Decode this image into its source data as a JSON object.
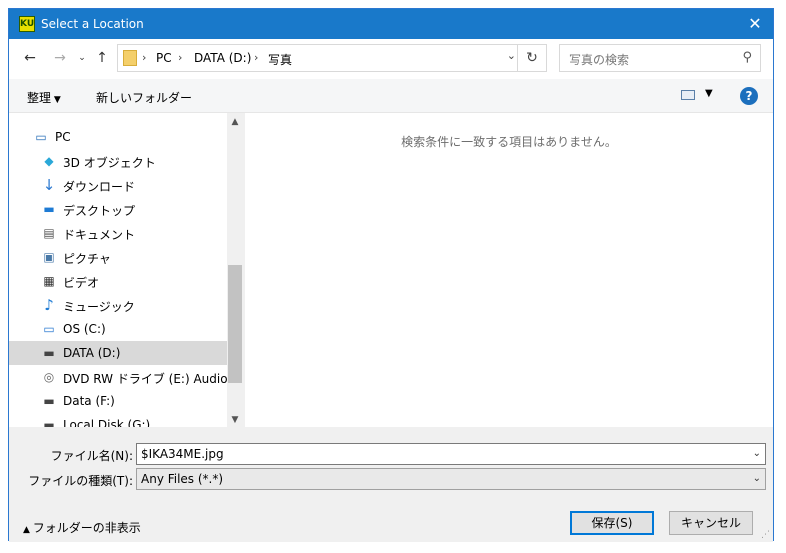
{
  "window": {
    "title": "Select a Location",
    "app_icon_text": "KU"
  },
  "nav": {
    "breadcrumb": [
      "PC",
      "DATA (D:)",
      "写真"
    ],
    "search_placeholder": "写真の検索"
  },
  "toolbar": {
    "organize_label": "整理",
    "new_folder_label": "新しいフォルダー"
  },
  "tree": {
    "items": [
      {
        "label": "PC",
        "icon": "computer-icon"
      },
      {
        "label": "3D オブジェクト",
        "icon": "cube-3d-icon"
      },
      {
        "label": "ダウンロード",
        "icon": "download-arrow-icon"
      },
      {
        "label": "デスクトップ",
        "icon": "desktop-icon"
      },
      {
        "label": "ドキュメント",
        "icon": "document-icon"
      },
      {
        "label": "ピクチャ",
        "icon": "picture-icon"
      },
      {
        "label": "ビデオ",
        "icon": "film-icon"
      },
      {
        "label": "ミュージック",
        "icon": "music-note-icon"
      },
      {
        "label": "OS (C:)",
        "icon": "windows-drive-icon"
      },
      {
        "label": "DATA (D:)",
        "icon": "drive-icon",
        "selected": true
      },
      {
        "label": "DVD RW ドライブ (E:) Audio CD",
        "icon": "cd-drive-icon"
      },
      {
        "label": "Data (F:)",
        "icon": "drive-icon"
      },
      {
        "label": "Local Disk (G:)",
        "icon": "drive-icon"
      }
    ]
  },
  "content": {
    "empty_message": "検索条件に一致する項目はありません。"
  },
  "form": {
    "filename_label": "ファイル名(N):",
    "filename_value": "$IKA34ME.jpg",
    "filetype_label": "ファイルの種類(T):",
    "filetype_value": "Any Files (*.*)"
  },
  "footer": {
    "hide_folders_label": "フォルダーの非表示",
    "save_label": "保存(S)",
    "cancel_label": "キャンセル"
  },
  "colors": {
    "titlebar": "#1979ca",
    "selection": "#d9d9d9",
    "accent": "#0078d7"
  }
}
